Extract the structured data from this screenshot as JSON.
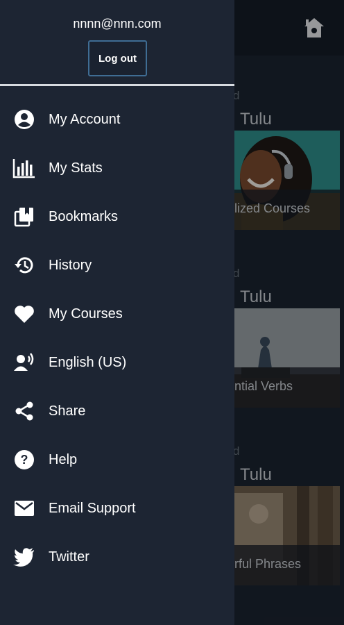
{
  "drawer": {
    "email": "nnnn@nnn.com",
    "logout_label": "Log out",
    "items": [
      {
        "label": "My Account",
        "icon": "account-circle-icon"
      },
      {
        "label": "My Stats",
        "icon": "stats-bars-icon"
      },
      {
        "label": "Bookmarks",
        "icon": "bookmarks-icon"
      },
      {
        "label": "History",
        "icon": "history-icon"
      },
      {
        "label": "My Courses",
        "icon": "heart-icon"
      },
      {
        "label": "English (US)",
        "icon": "voice-language-icon"
      },
      {
        "label": "Share",
        "icon": "share-icon"
      },
      {
        "label": "Help",
        "icon": "help-icon"
      },
      {
        "label": "Email Support",
        "icon": "mail-icon"
      },
      {
        "label": "Twitter",
        "icon": "twitter-icon"
      }
    ]
  },
  "background": {
    "cards": [
      {
        "kicker": "d",
        "lang": "Tulu",
        "caption": "alized Courses"
      },
      {
        "kicker": "d",
        "lang": "Tulu",
        "caption": "ential Verbs"
      },
      {
        "kicker": "d",
        "lang": "Tulu",
        "caption": "erful Phrases"
      }
    ]
  },
  "colors": {
    "drawer_bg": "#1d2533",
    "accent_border": "#3f6d94",
    "text": "#ffffff"
  }
}
